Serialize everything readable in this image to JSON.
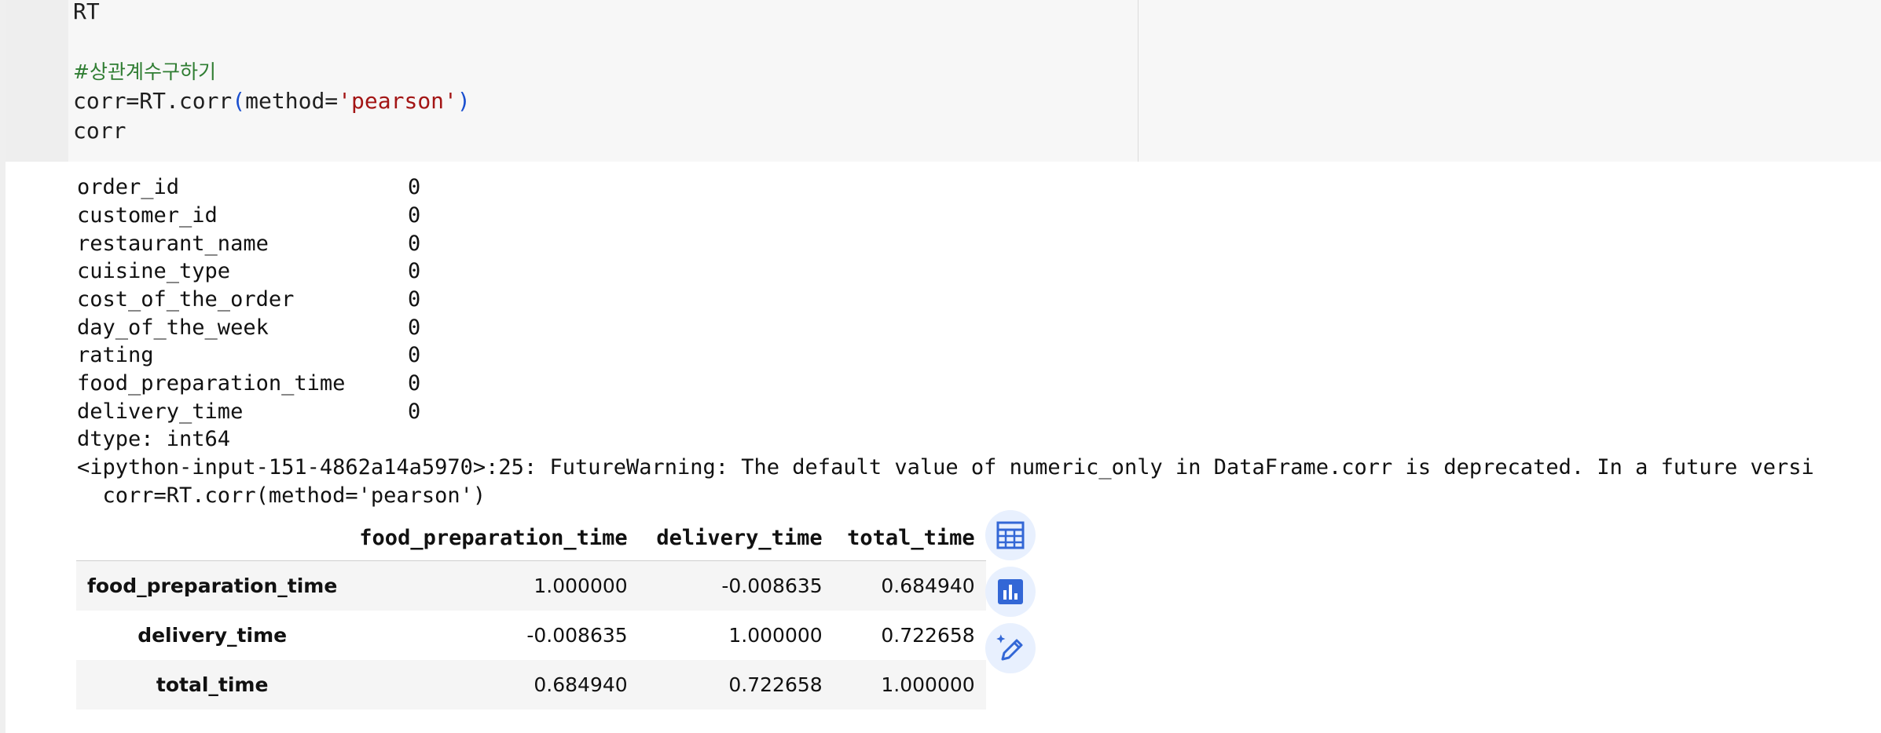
{
  "code": {
    "line1": "RT",
    "comment": "#상관계수구하기",
    "line3_prefix": "corr=RT.corr",
    "line3_open": "(",
    "line3_kw": "method=",
    "line3_str": "'pearson'",
    "line3_close": ")",
    "line4": "corr"
  },
  "output": {
    "series": [
      {
        "name": "order_id",
        "value": "0"
      },
      {
        "name": "customer_id",
        "value": "0"
      },
      {
        "name": "restaurant_name",
        "value": "0"
      },
      {
        "name": "cuisine_type",
        "value": "0"
      },
      {
        "name": "cost_of_the_order",
        "value": "0"
      },
      {
        "name": "day_of_the_week",
        "value": "0"
      },
      {
        "name": "rating",
        "value": "0"
      },
      {
        "name": "food_preparation_time",
        "value": "0"
      },
      {
        "name": "delivery_time",
        "value": "0"
      }
    ],
    "dtype": "dtype: int64",
    "warning": "<ipython-input-151-4862a14a5970>:25: FutureWarning: The default value of numeric_only in DataFrame.corr is deprecated. In a future versi",
    "warning_code": "  corr=RT.corr(method='pearson')"
  },
  "dataframe": {
    "columns": [
      "",
      "food_preparation_time",
      "delivery_time",
      "total_time"
    ],
    "rows": [
      {
        "index": "food_preparation_time",
        "values": [
          "1.000000",
          "-0.008635",
          "0.684940"
        ]
      },
      {
        "index": "delivery_time",
        "values": [
          "-0.008635",
          "1.000000",
          "0.722658"
        ]
      },
      {
        "index": "total_time",
        "values": [
          "0.684940",
          "0.722658",
          "1.000000"
        ]
      }
    ]
  },
  "tools": {
    "icons": [
      "table-icon",
      "bar-chart-icon",
      "magic-edit-icon"
    ],
    "accent": "#3367d6",
    "background": "#e8f0fe"
  }
}
